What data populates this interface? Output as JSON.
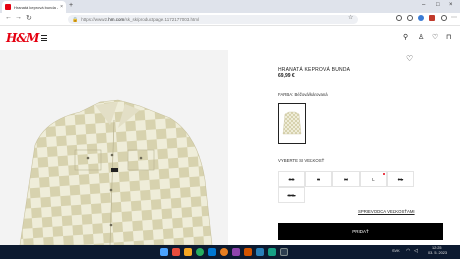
{
  "browser": {
    "tab_title": "Hranatá keprová bunda - Béžo",
    "url_prefix": "https://www2.",
    "url_domain": "hm.com",
    "url_path": "/sk_sk/productpage.1172177003.html"
  },
  "site": {
    "logo": "H&M"
  },
  "product": {
    "title": "HRANATÁ KEPROVÁ BUNDA",
    "price": "69,99 €",
    "color_label": "FARBA: Béžová/károvaná",
    "size_heading": "VYBERTE SI VEĽKOSŤ",
    "sizes": [
      "XS",
      "S",
      "M",
      "L",
      "XL",
      "XXL"
    ],
    "size_guide": "SPRIEVODCA VEĽKOSŤAMI",
    "add_button": "PRIDAŤ"
  },
  "taskbar": {
    "lang": "SVK",
    "time": "12:25",
    "date": "03. 5. 2023"
  },
  "colors": {
    "brand": "#e50010",
    "checker_light": "#efedd9",
    "checker_dark": "#d7d2ae",
    "taskbar": "#0c1a30"
  }
}
